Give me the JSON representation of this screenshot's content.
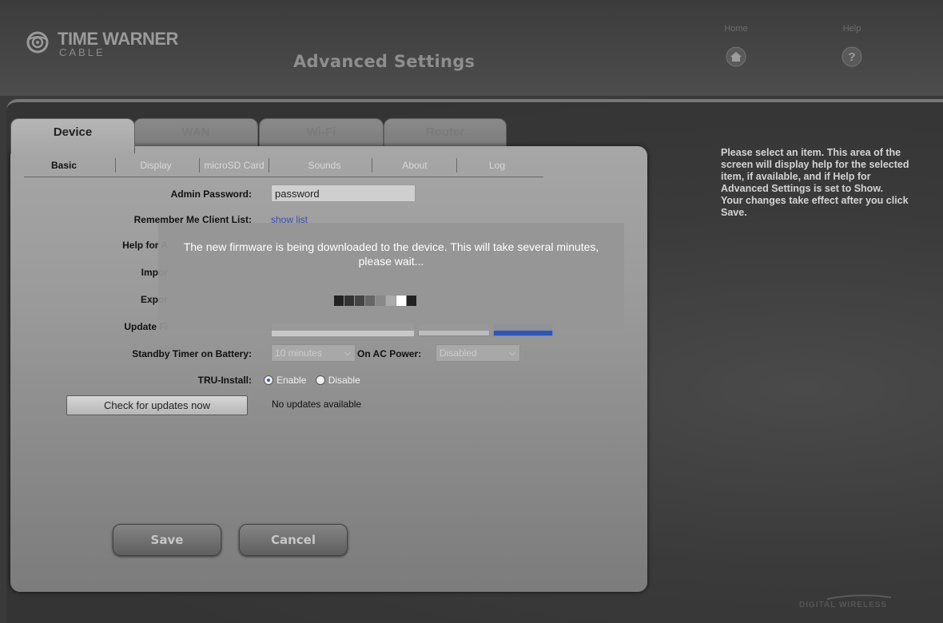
{
  "header": {
    "logo_line1": "TIME WARNER",
    "logo_line2": "CABLE",
    "title": "Advanced Settings",
    "nav": {
      "home": "Home",
      "help": "Help"
    }
  },
  "tabs": [
    {
      "label": "Device",
      "active": true
    },
    {
      "label": "WAN",
      "active": false
    },
    {
      "label": "Wi-Fi",
      "active": false
    },
    {
      "label": "Router",
      "active": false
    }
  ],
  "subtabs": [
    {
      "label": "Basic",
      "active": true
    },
    {
      "label": "Display",
      "active": false
    },
    {
      "label": "microSD Card",
      "active": false
    },
    {
      "label": "Sounds",
      "active": false
    },
    {
      "label": "About",
      "active": false
    },
    {
      "label": "Log",
      "active": false
    }
  ],
  "form": {
    "admin_password_label": "Admin Password:",
    "admin_password_value": "password",
    "remember_label": "Remember Me Client List:",
    "remember_link": "show list",
    "help_label_partial": "Help for A",
    "import_label_partial": "Impor",
    "export_label_partial": "Expor",
    "update_label_partial": "Update Fi",
    "standby_label": "Standby Timer on Battery:",
    "standby_value": "10 minutes",
    "ac_power_label": "On AC Power:",
    "ac_power_value": "Disabled",
    "tru_install_label": "TRU-Install:",
    "tru_enable": "Enable",
    "tru_disable": "Disable",
    "tru_selected": "Enable",
    "check_button": "Check for updates now",
    "update_status": "No updates available"
  },
  "actions": {
    "save": "Save",
    "cancel": "Cancel"
  },
  "help_panel": {
    "text": "Please select an item. This area of the screen will display help for the selected item, if available, and if Help for Advanced Settings is set to Show.",
    "text2": "Your changes take effect after you click Save."
  },
  "modal": {
    "message": "The new firmware is being downloaded to the device. This will take several minutes, please wait...",
    "progress_blocks": [
      "#222222",
      "#333333",
      "#444444",
      "#666666",
      "#888888",
      "#aaaaaa",
      "#ffffff",
      "#222222"
    ]
  },
  "brand_corner": "DIGITAL WIRELESS",
  "icons": {
    "home": "home-icon",
    "help": "help-icon",
    "logo": "twc-eye-logo-icon",
    "chevron": "chevron-down-icon"
  }
}
